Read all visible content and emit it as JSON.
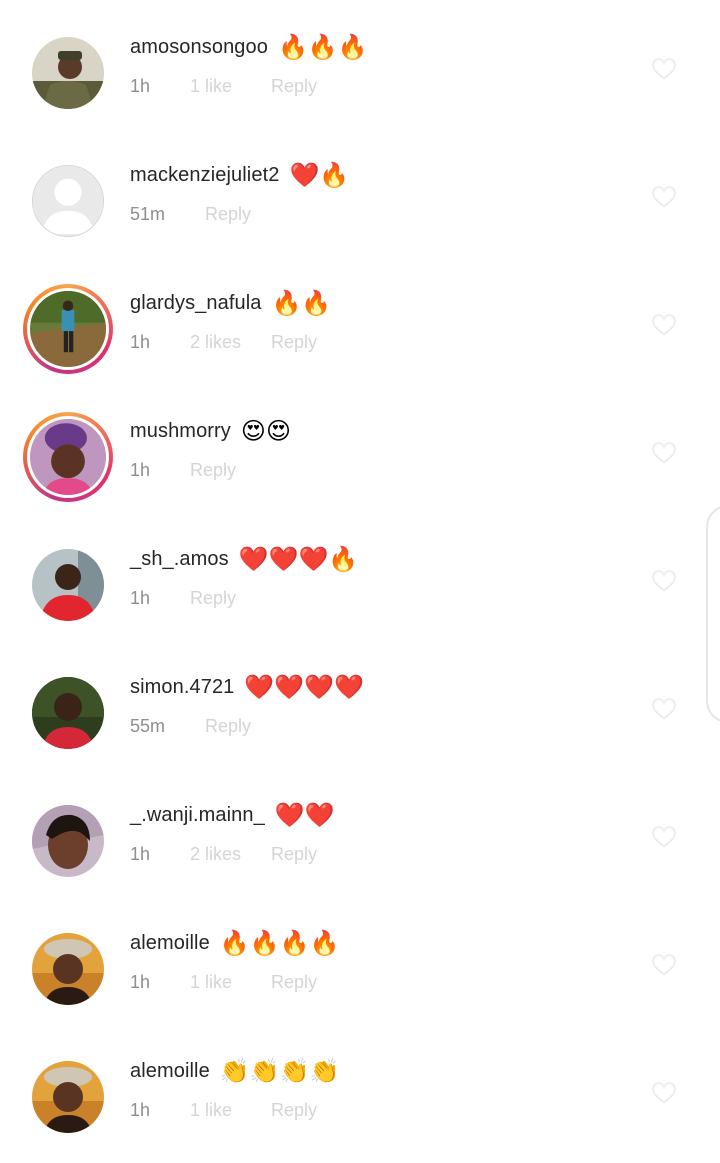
{
  "comments": [
    {
      "username": "amosonsongoo",
      "text": "🔥🔥🔥",
      "time": "1h",
      "likes": "1 like",
      "reply": "Reply",
      "story": false
    },
    {
      "username": "mackenziejuliet2",
      "text": "❤️🔥",
      "time": "51m",
      "likes": "",
      "reply": "Reply",
      "story": false
    },
    {
      "username": "glardys_nafula",
      "text": "🔥🔥",
      "time": "1h",
      "likes": "2 likes",
      "reply": "Reply",
      "story": true
    },
    {
      "username": "mushmorry",
      "text": "😍😍",
      "time": "1h",
      "likes": "",
      "reply": "Reply",
      "story": true
    },
    {
      "username": "_sh_.amos",
      "text": "❤️❤️❤️🔥",
      "time": "1h",
      "likes": "",
      "reply": "Reply",
      "story": false
    },
    {
      "username": "simon.4721",
      "text": "❤️❤️❤️❤️",
      "time": "55m",
      "likes": "",
      "reply": "Reply",
      "story": false
    },
    {
      "username": "_.wanji.mainn_",
      "text": "❤️❤️",
      "time": "1h",
      "likes": "2 likes",
      "reply": "Reply",
      "story": false
    },
    {
      "username": "alemoille",
      "text": "🔥🔥🔥🔥",
      "time": "1h",
      "likes": "1 like",
      "reply": "Reply",
      "story": false
    },
    {
      "username": "alemoille",
      "text": "👏👏👏👏",
      "time": "1h",
      "likes": "1 like",
      "reply": "Reply",
      "story": false
    }
  ],
  "icons": {
    "like": "heart-outline-icon",
    "avatar_placeholder": "default-user-icon"
  },
  "colors": {
    "username": "#262626",
    "time": "#8e8e8e",
    "secondary": "#d4d4d4",
    "story_ring_start": "#f9a44a",
    "story_ring_end": "#e1306c"
  }
}
